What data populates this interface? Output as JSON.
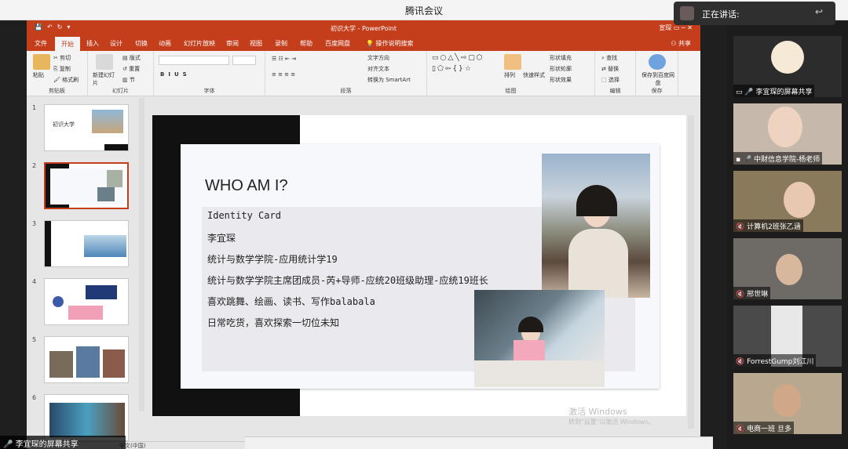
{
  "meeting": {
    "title": "腾讯会议",
    "speaking_label": "正在讲话:",
    "sharer_label": "李宜琛的屏幕共享"
  },
  "ppt": {
    "doc_title": "初识大学 - PowerPoint",
    "user_label": "宣琛",
    "share_button": "共享",
    "tabs": [
      "文件",
      "开始",
      "插入",
      "设计",
      "切换",
      "动画",
      "幻灯片放映",
      "审阅",
      "视图",
      "录制",
      "帮助",
      "百度网盘",
      "操作说明搜索"
    ],
    "active_tab": "开始",
    "ribbon": {
      "clipboard": {
        "paste": "粘贴",
        "cut": "剪切",
        "copy": "复制",
        "format": "格式刷",
        "label": "剪贴板"
      },
      "slides": {
        "new": "新建幻灯片",
        "layout": "版式",
        "reset": "重置",
        "section": "节",
        "label": "幻灯片"
      },
      "font": {
        "label": "字体"
      },
      "paragraph": {
        "text_dir": "文字方向",
        "align": "对齐文本",
        "smartart": "转换为 SmartArt",
        "label": "段落"
      },
      "drawing": {
        "arrange": "排列",
        "quick_styles": "快速样式",
        "fill": "形状填充",
        "outline": "形状轮廓",
        "effects": "形状效果",
        "label": "绘图"
      },
      "editing": {
        "find": "查找",
        "replace": "替换",
        "select": "选择",
        "label": "编辑"
      },
      "save": {
        "save_to": "保存到百度网盘",
        "label": "保存"
      }
    },
    "thumbnails": [
      "1",
      "2",
      "3",
      "4",
      "5",
      "6"
    ],
    "thumb1_text": "初识大学",
    "selected_slide": 2,
    "status_lang": "中文(中国)"
  },
  "slide": {
    "title": "WHO AM I?",
    "lines": [
      "Identity Card",
      "李宜琛",
      "统计与数学学院-应用统计学19",
      "统计与数学学院主席团成员-芮+导师-应统20班级助理-应统19班长",
      "喜欢跳舞、绘画、读书、写作balabala",
      "日常吃货，喜欢探索一切位未知"
    ],
    "watermark": "激活 Windows",
    "watermark_sub": "转到\"设置\"以激活 Windows。"
  },
  "participants": [
    {
      "name": "李宜琛的屏幕共享"
    },
    {
      "name": "中财信息学院-杨老师"
    },
    {
      "name": "计算机2班张乙涵"
    },
    {
      "name": "邢世琳"
    },
    {
      "name": "ForrestGump刘江川"
    },
    {
      "name": "电商一班 旦多"
    }
  ]
}
